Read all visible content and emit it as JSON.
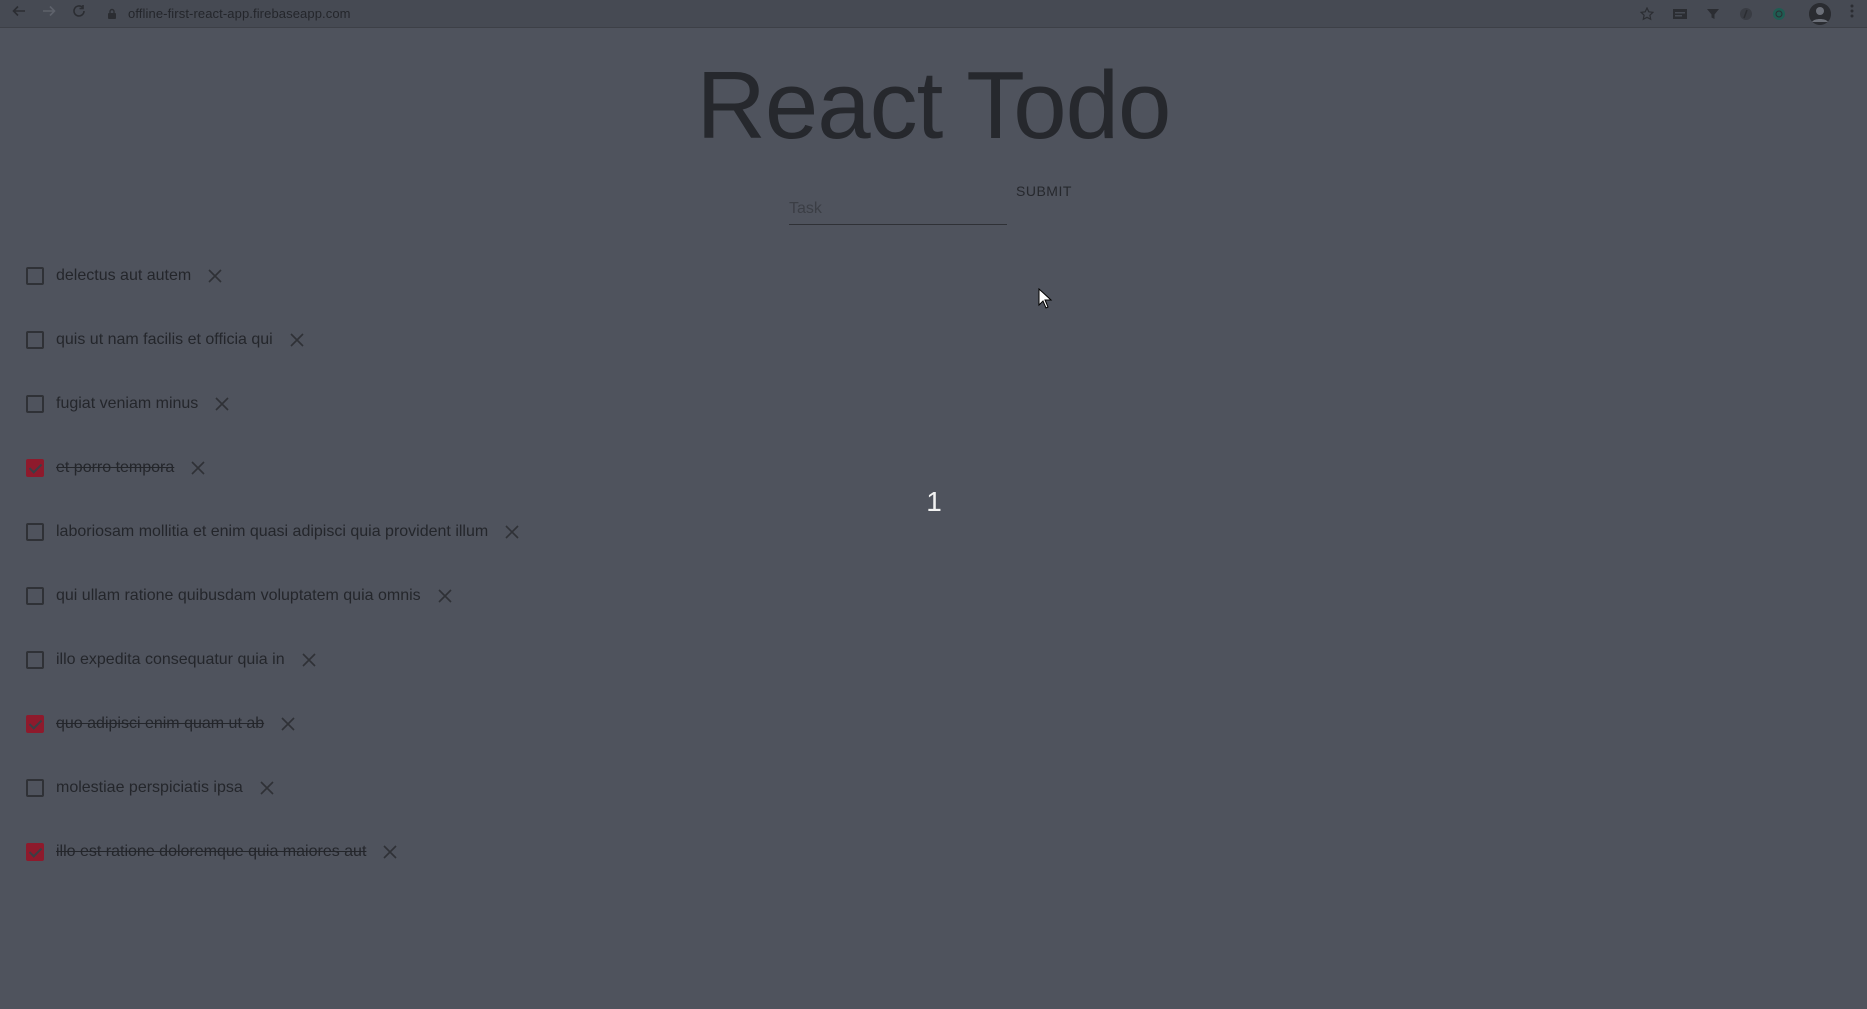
{
  "browser": {
    "url": "offline-first-react-app.firebaseapp.com",
    "icons": {
      "back": "arrow-left-icon",
      "forward": "arrow-right-icon",
      "reload": "reload-icon",
      "lock": "lock-icon",
      "bookmark": "star-icon",
      "menu": "more-vertical-icon"
    }
  },
  "app": {
    "title": "React Todo",
    "input_placeholder": "Task",
    "input_value": "",
    "submit_label": "SUBMIT",
    "counter": "1"
  },
  "todos": [
    {
      "text": "delectus aut autem",
      "completed": false
    },
    {
      "text": "quis ut nam facilis et officia qui",
      "completed": false
    },
    {
      "text": "fugiat veniam minus",
      "completed": false
    },
    {
      "text": "et porro tempora",
      "completed": true
    },
    {
      "text": "laboriosam mollitia et enim quasi adipisci quia provident illum",
      "completed": false
    },
    {
      "text": "qui ullam ratione quibusdam voluptatem quia omnis",
      "completed": false
    },
    {
      "text": "illo expedita consequatur quia in",
      "completed": false
    },
    {
      "text": "quo adipisci enim quam ut ab",
      "completed": true
    },
    {
      "text": "molestiae perspiciatis ipsa",
      "completed": false
    },
    {
      "text": "illo est ratione doloremque quia maiores aut",
      "completed": true
    }
  ],
  "colors": {
    "background": "#4f535d",
    "checked": "#8e1a2c",
    "counter": "#f2f2f2"
  }
}
